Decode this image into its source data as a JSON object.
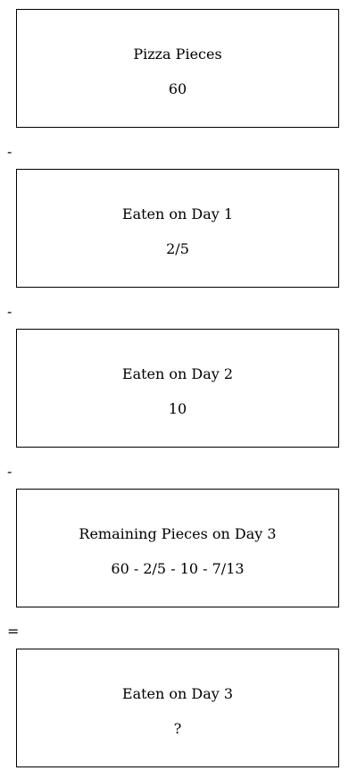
{
  "boxes": [
    {
      "label": "Pizza Pieces",
      "value": "60"
    },
    {
      "label": "Eaten on Day 1",
      "value": "2/5"
    },
    {
      "label": "Eaten on Day 2",
      "value": "10"
    },
    {
      "label": "Remaining Pieces on Day 3",
      "value": "60 - 2/5 - 10 - 7/13"
    },
    {
      "label": "Eaten on Day 3",
      "value": "?"
    }
  ],
  "operators": [
    "-",
    "-",
    "-",
    "="
  ]
}
